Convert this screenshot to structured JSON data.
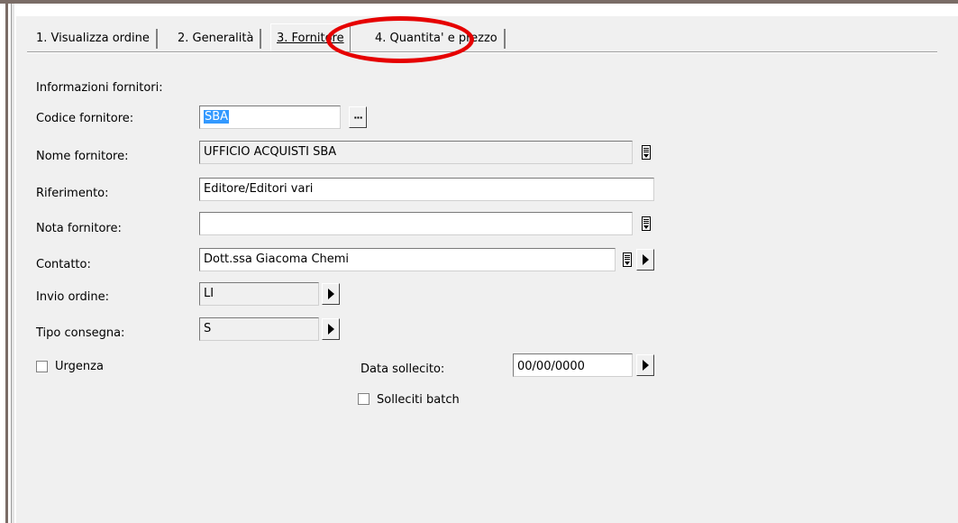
{
  "tabs": [
    {
      "label": "1. Visualizza ordine"
    },
    {
      "label": "2. Generalità"
    },
    {
      "label": "3. Fornitore"
    },
    {
      "label": "4. Quantita' e prezzo"
    }
  ],
  "section_title": "Informazioni fornitori:",
  "fields": {
    "codice_fornitore": {
      "label": "Codice fornitore:",
      "value": "SBA"
    },
    "nome_fornitore": {
      "label": "Nome fornitore:",
      "value": "UFFICIO ACQUISTI SBA"
    },
    "riferimento": {
      "label": "Riferimento:",
      "value": "Editore/Editori vari"
    },
    "nota_fornitore": {
      "label": "Nota fornitore:",
      "value": ""
    },
    "contatto": {
      "label": "Contatto:",
      "value": "Dott.ssa Giacoma Chemi"
    },
    "invio_ordine": {
      "label": "Invio ordine:",
      "value": "LI"
    },
    "tipo_consegna": {
      "label": "Tipo consegna:",
      "value": "S"
    },
    "data_sollecito": {
      "label": "Data sollecito:",
      "value": "00/00/0000"
    }
  },
  "checkboxes": {
    "urgenza": {
      "label": "Urgenza",
      "checked": false
    },
    "solleciti_batch": {
      "label": "Solleciti batch",
      "checked": false
    }
  },
  "buttons": {
    "lookup_label": "···"
  },
  "annotation": {
    "color": "#e60000"
  }
}
